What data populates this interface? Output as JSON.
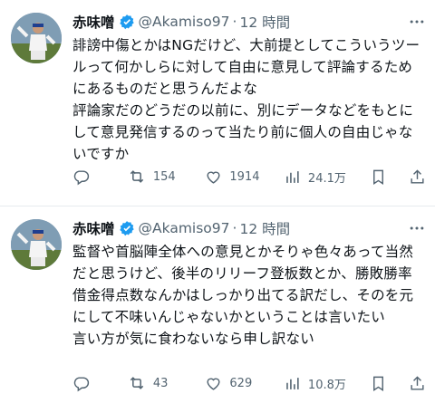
{
  "tweets": [
    {
      "author": {
        "name": "赤味噌",
        "handle": "@Akamiso97",
        "time": "12 時間"
      },
      "text": "誹謗中傷とかはNGだけど、大前提としてこういうツールって何かしらに対して自由に意見して評論するためにあるものだと思うんだよな\n評論家だのどうだの以前に、別にデータなどをもとにして意見発信するのって当たり前に個人の自由じゃないですか",
      "stats": {
        "reply": "",
        "retweet": "154",
        "like": "1914",
        "views": "24.1万"
      }
    },
    {
      "author": {
        "name": "赤味噌",
        "handle": "@Akamiso97",
        "time": "12 時間"
      },
      "text": "監督や首脳陣全体への意見とかそりゃ色々あって当然だと思うけど、後半のリリーフ登板数とか、勝敗勝率借金得点数なんかはしっかり出てる訳だし、そのを元にして不味いんじゃないかということは言いたい\n言い方が気に食わないなら申し訳ない",
      "stats": {
        "reply": "",
        "retweet": "43",
        "like": "629",
        "views": "10.8万"
      }
    }
  ],
  "colors": {
    "verified": "#1d9bf0",
    "muted": "#536471",
    "text": "#0f1419"
  },
  "icons": [
    "verified-badge-icon",
    "more-icon",
    "reply-icon",
    "retweet-icon",
    "like-icon",
    "views-icon",
    "bookmark-icon",
    "share-icon"
  ]
}
